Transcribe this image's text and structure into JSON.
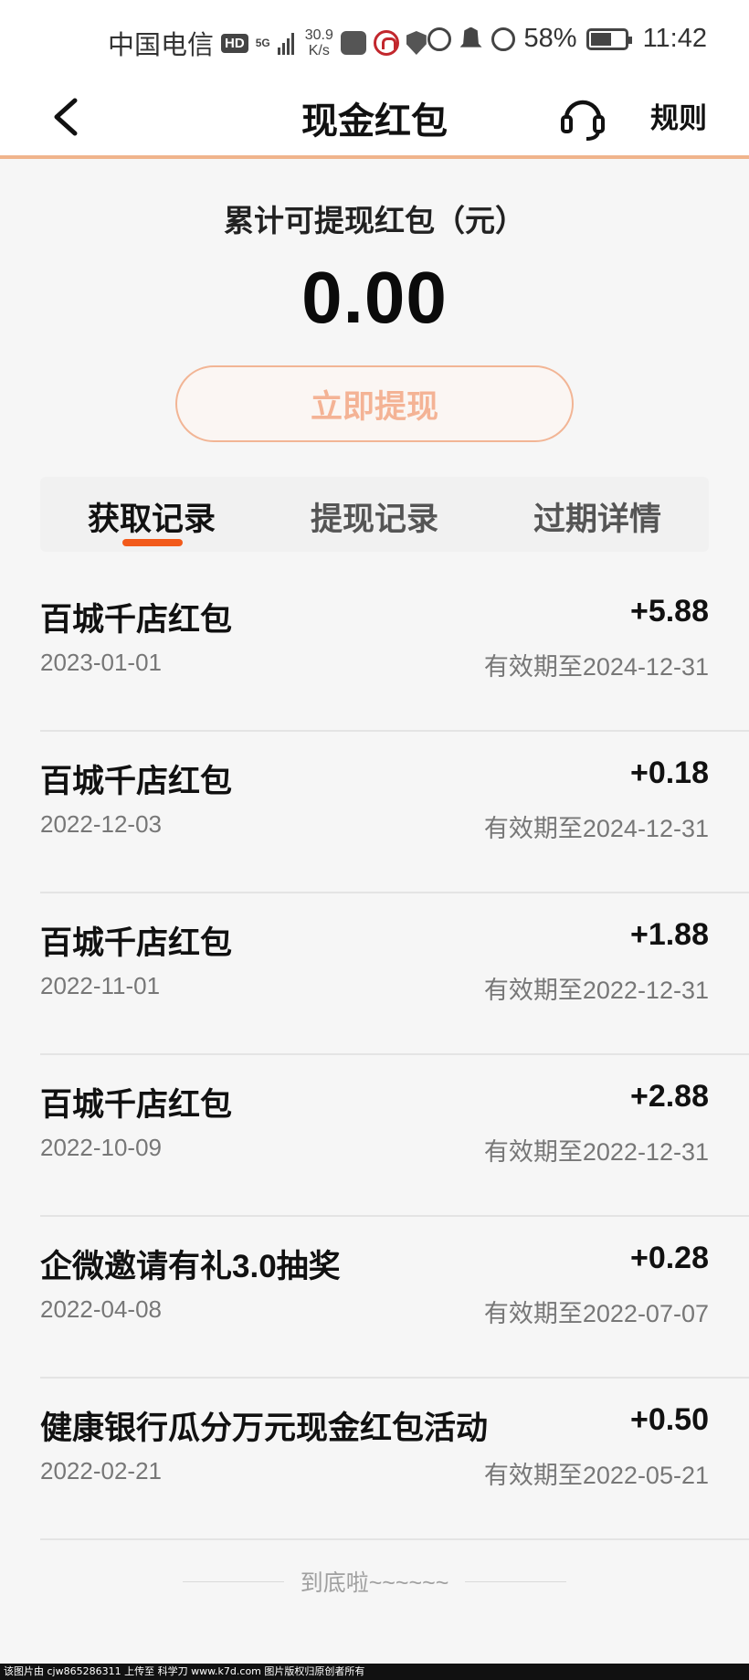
{
  "status_bar": {
    "carrier": "中国电信",
    "hd": "HD",
    "network": "5G",
    "speed_value": "30.9",
    "speed_unit": "K/s",
    "battery": "58%",
    "time": "11:42"
  },
  "header": {
    "title": "现金红包",
    "rules_label": "规则"
  },
  "balance": {
    "label": "累计可提现红包（元）",
    "amount": "0.00",
    "withdraw_label": "立即提现"
  },
  "tabs": [
    {
      "label": "获取记录",
      "active": true
    },
    {
      "label": "提现记录",
      "active": false
    },
    {
      "label": "过期详情",
      "active": false
    }
  ],
  "records": [
    {
      "name": "百城千店红包",
      "amount": "+5.88",
      "date": "2023-01-01",
      "expiry": "有效期至2024-12-31"
    },
    {
      "name": "百城千店红包",
      "amount": "+0.18",
      "date": "2022-12-03",
      "expiry": "有效期至2024-12-31"
    },
    {
      "name": "百城千店红包",
      "amount": "+1.88",
      "date": "2022-11-01",
      "expiry": "有效期至2022-12-31"
    },
    {
      "name": "百城千店红包",
      "amount": "+2.88",
      "date": "2022-10-09",
      "expiry": "有效期至2022-12-31"
    },
    {
      "name": "企微邀请有礼3.0抽奖",
      "amount": "+0.28",
      "date": "2022-04-08",
      "expiry": "有效期至2022-07-07"
    },
    {
      "name": "健康银行瓜分万元现金红包活动",
      "amount": "+0.50",
      "date": "2022-02-21",
      "expiry": "有效期至2022-05-21"
    }
  ],
  "end_text": "到底啦~~~~~~",
  "footer_watermark": "该图片由 cjw865286311 上传至 科学刀 www.k7d.com 图片版权归原创者所有",
  "colors": {
    "accent": "#f25a1b",
    "button_border": "#f2b595",
    "header_divider": "#f0b48c",
    "background": "#f6f6f6"
  },
  "icons": [
    "back-arrow-icon",
    "headset-icon"
  ]
}
